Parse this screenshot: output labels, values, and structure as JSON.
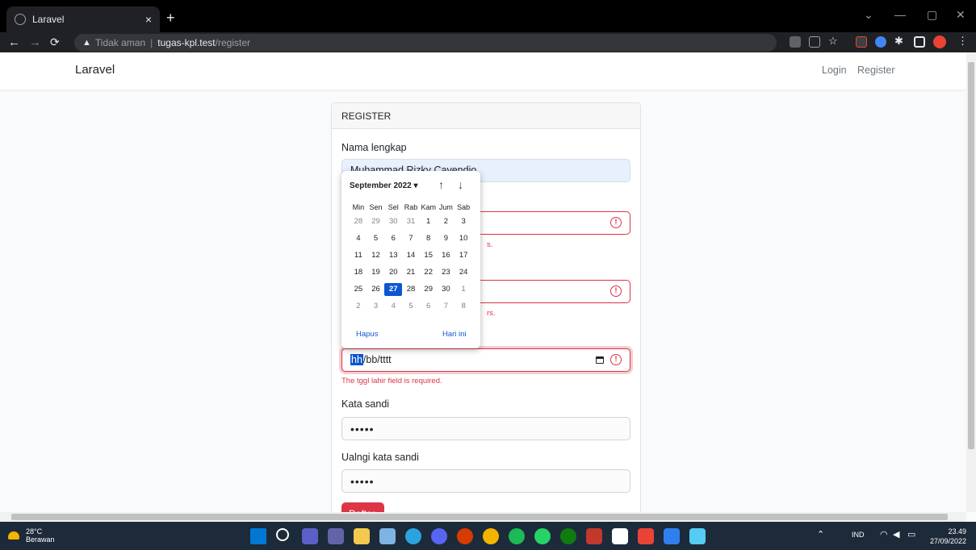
{
  "browser": {
    "tab_title": "Laravel",
    "tab_close": "×",
    "new_tab": "+",
    "security_label": "Tidak aman",
    "url_host": "tugas-kpl.test",
    "url_path": "/register"
  },
  "navbar": {
    "brand": "Laravel",
    "login": "Login",
    "register": "Register"
  },
  "form": {
    "header": "REGISTER",
    "nama_label": "Nama lengkap",
    "nama_value": "Muhammad Rizky Cavendio",
    "email_error_suffix": "s.",
    "phone_error_suffix": "rs.",
    "date_value_day": "hh",
    "date_value_rest": "/bb/tttt",
    "date_error": "The tggl lahir field is required.",
    "password_label": "Kata sandi",
    "password_value": "•••••",
    "confirm_label": "Ualngi kata sandi",
    "confirm_value": "•••••",
    "submit_label": "Daftar"
  },
  "datepicker": {
    "month_label": "September 2022 ▾",
    "up_arrow": "↑",
    "down_arrow": "↓",
    "weekdays": [
      "Min",
      "Sen",
      "Sel",
      "Rab",
      "Kam",
      "Jum",
      "Sab"
    ],
    "weeks": [
      [
        {
          "d": "28",
          "o": true
        },
        {
          "d": "29",
          "o": true
        },
        {
          "d": "30",
          "o": true
        },
        {
          "d": "31",
          "o": true
        },
        {
          "d": "1"
        },
        {
          "d": "2"
        },
        {
          "d": "3"
        }
      ],
      [
        {
          "d": "4"
        },
        {
          "d": "5"
        },
        {
          "d": "6"
        },
        {
          "d": "7"
        },
        {
          "d": "8"
        },
        {
          "d": "9"
        },
        {
          "d": "10"
        }
      ],
      [
        {
          "d": "11"
        },
        {
          "d": "12"
        },
        {
          "d": "13"
        },
        {
          "d": "14"
        },
        {
          "d": "15"
        },
        {
          "d": "16"
        },
        {
          "d": "17"
        }
      ],
      [
        {
          "d": "18"
        },
        {
          "d": "19"
        },
        {
          "d": "20"
        },
        {
          "d": "21"
        },
        {
          "d": "22"
        },
        {
          "d": "23"
        },
        {
          "d": "24"
        }
      ],
      [
        {
          "d": "25"
        },
        {
          "d": "26"
        },
        {
          "d": "27",
          "s": true
        },
        {
          "d": "28"
        },
        {
          "d": "29"
        },
        {
          "d": "30"
        },
        {
          "d": "1",
          "o": true
        }
      ],
      [
        {
          "d": "2",
          "o": true
        },
        {
          "d": "3",
          "o": true
        },
        {
          "d": "4",
          "o": true
        },
        {
          "d": "5",
          "o": true
        },
        {
          "d": "6",
          "o": true
        },
        {
          "d": "7",
          "o": true
        },
        {
          "d": "8",
          "o": true
        }
      ]
    ],
    "clear_label": "Hapus",
    "today_label": "Hari ini"
  },
  "taskbar": {
    "temperature": "28°C",
    "weather": "Berawan",
    "language": "IND",
    "time": "23.49",
    "date": "27/09/2022",
    "icons": [
      "windows-start-icon",
      "search-icon",
      "task-view-icon",
      "chat-icon",
      "file-explorer-icon",
      "calculator-icon",
      "telegram-icon",
      "discord-icon",
      "office-icon",
      "chrome-icon",
      "spotify-icon",
      "whatsapp-icon",
      "xbox-icon",
      "app-icon",
      "notion-icon",
      "chrome-canary-icon",
      "vscode-icon",
      "photos-icon"
    ]
  },
  "colors": {
    "danger": "#dc3545",
    "accent": "#0b57d0",
    "taskbar_bg": "#1c2a3a"
  }
}
